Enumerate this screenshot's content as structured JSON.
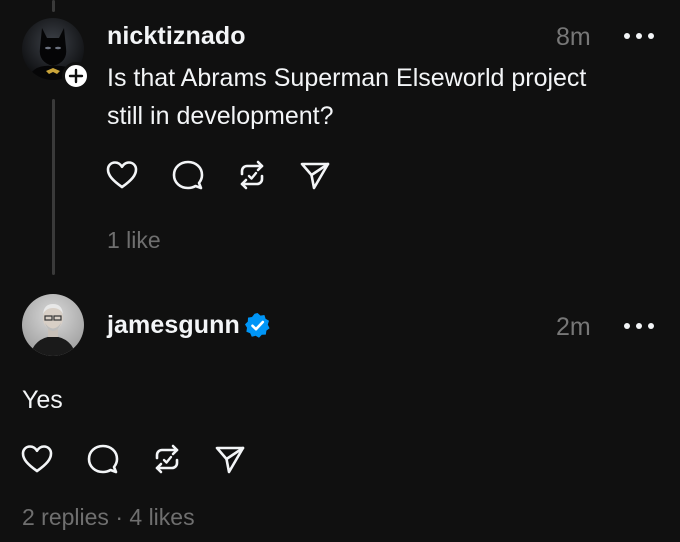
{
  "post1": {
    "username": "nicktiznado",
    "time": "8m",
    "text_line1": "Is that Abrams Superman Elseworld project",
    "text_line2": "still in development?",
    "likes": "1 like"
  },
  "post2": {
    "username": "jamesgunn",
    "time": "2m",
    "text": "Yes",
    "replies": "2 replies",
    "separator": "·",
    "likes": "4 likes"
  },
  "icons": {
    "like": "heart-icon",
    "reply": "comment-icon",
    "repost": "repost-icon",
    "share": "send-icon",
    "more": "more-icon",
    "verified": "verified-badge-icon",
    "follow": "plus-icon"
  },
  "colors": {
    "background": "#101010",
    "text": "#f3f5f7",
    "muted": "#777777",
    "verified": "#0095f6"
  }
}
